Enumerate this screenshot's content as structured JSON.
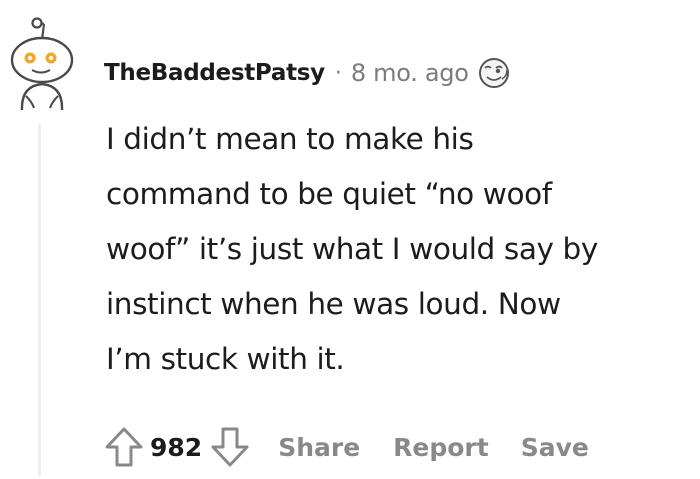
{
  "comment": {
    "author": "TheBaddestPatsy",
    "separator": "·",
    "timestamp": "8 mo. ago",
    "body_lines": [
      "I didn’t mean to make his",
      "command to be quiet “no woof",
      "woof” it’s just what I would say by",
      "instinct when he was loud. Now",
      "I’m stuck with it."
    ],
    "score": "982",
    "actions": {
      "share_label": "Share",
      "report_label": "Report",
      "save_label": "Save"
    },
    "icons": {
      "avatar": "snoo-avatar-icon",
      "award": "award-icon",
      "upvote": "upvote-arrow-icon",
      "downvote": "downvote-arrow-icon"
    },
    "colors": {
      "text": "#1c1c1c",
      "meta": "#7c7c7c",
      "action": "#878a8c",
      "thread_line": "#edeff1",
      "avatar_eye": "#f5a623"
    }
  }
}
